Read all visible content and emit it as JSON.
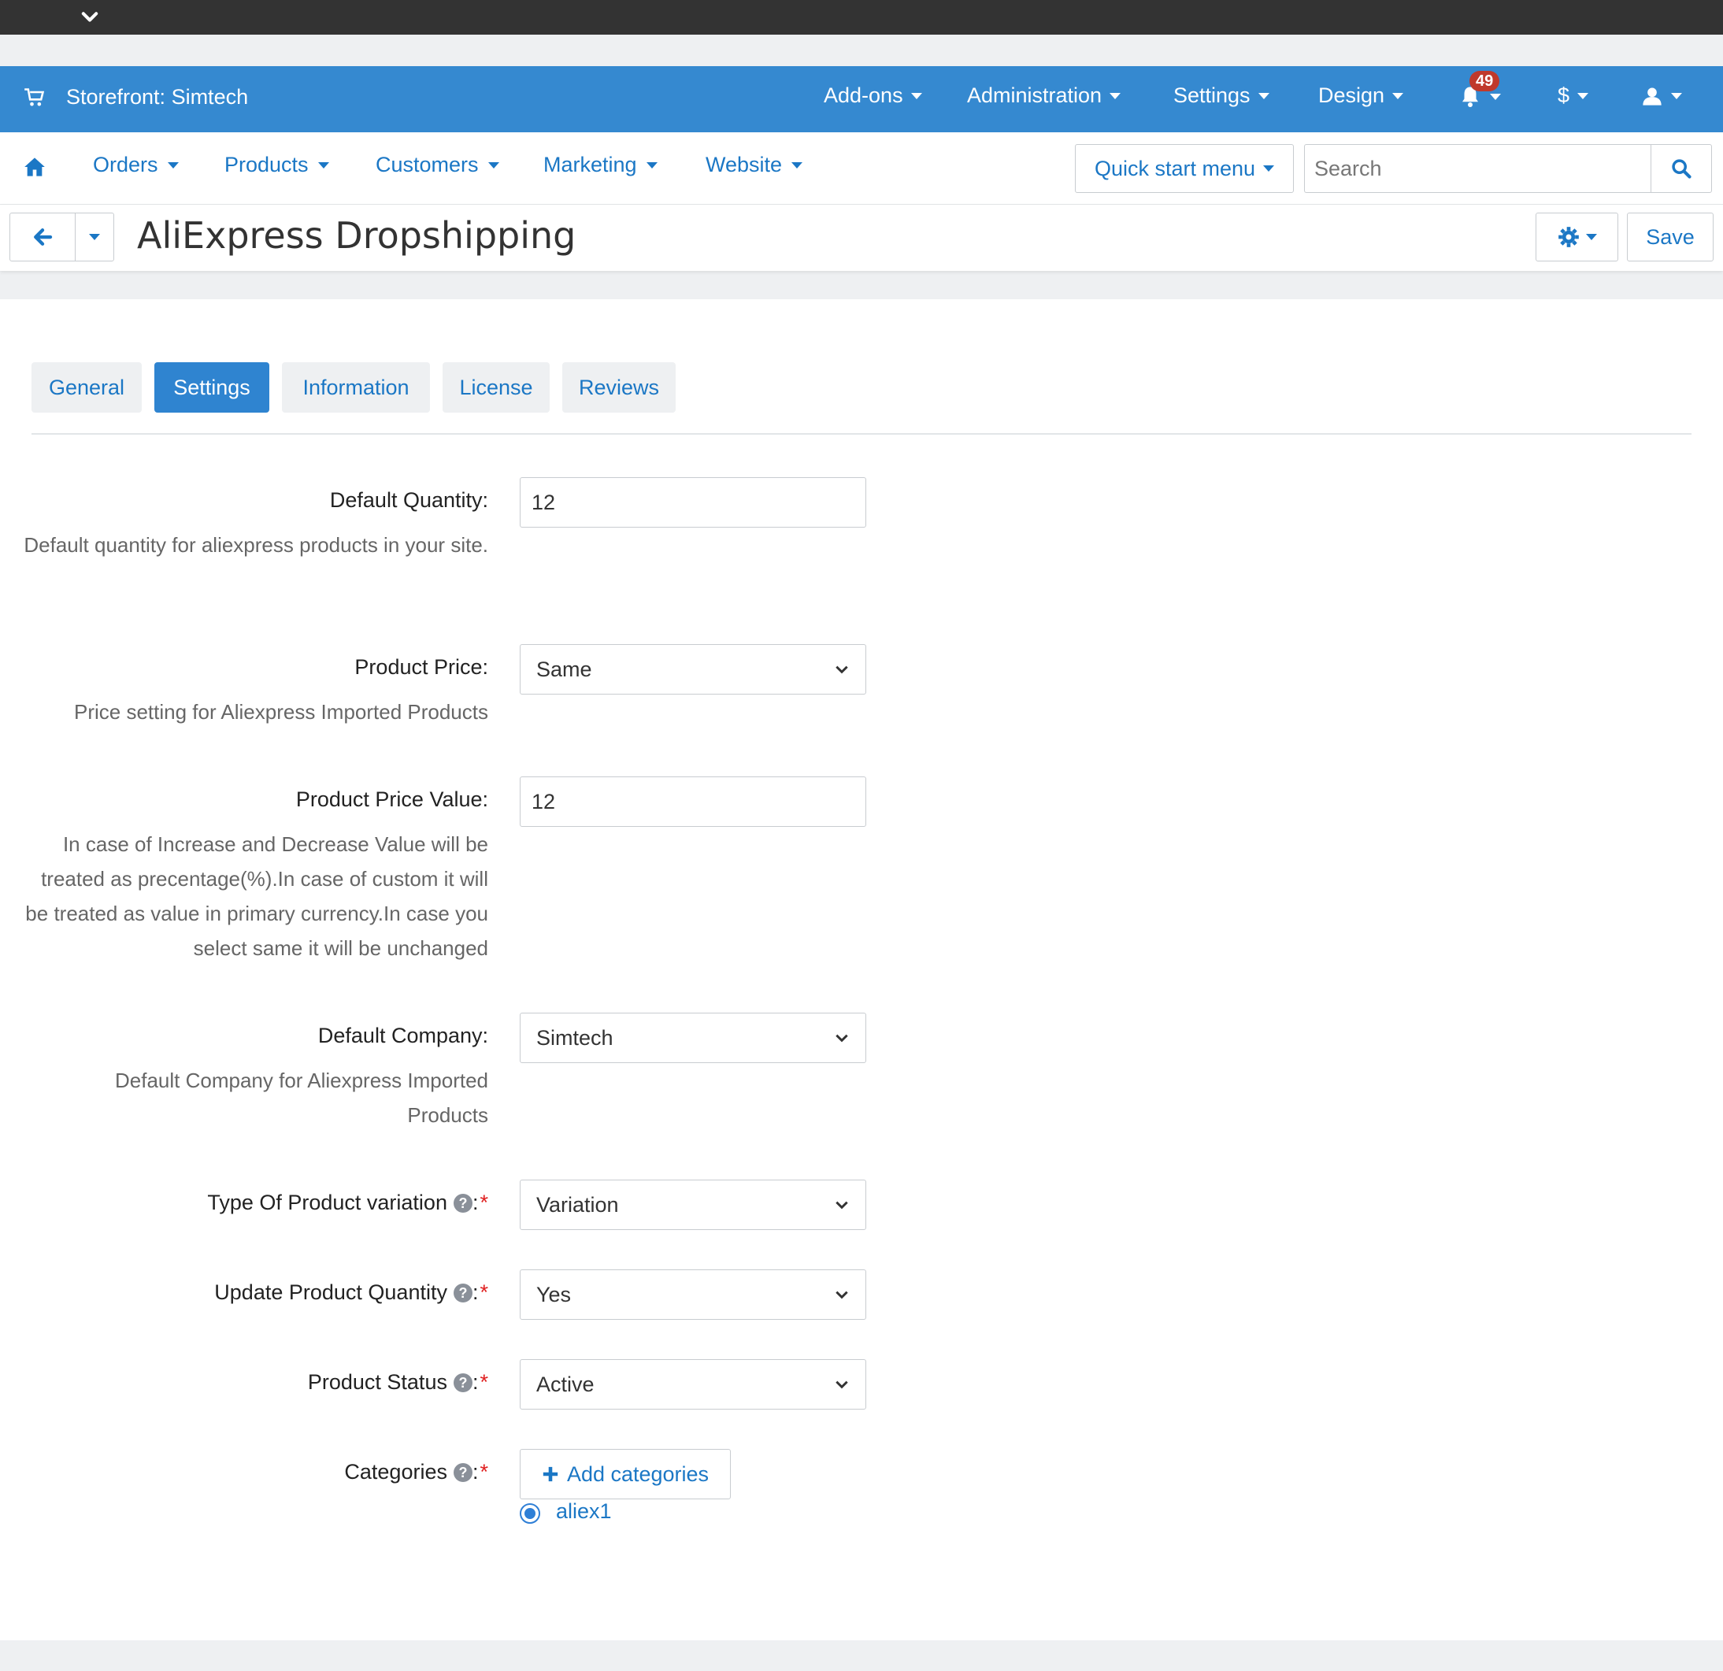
{
  "topbar": {
    "collapse_icon": "chevron-down-icon"
  },
  "header": {
    "storefront": "Storefront: Simtech",
    "menus": [
      "Add-ons",
      "Administration",
      "Settings",
      "Design"
    ],
    "notifications_count": "49",
    "currency": "$"
  },
  "nav": {
    "items": [
      "Orders",
      "Products",
      "Customers",
      "Marketing",
      "Website"
    ],
    "quick_start": "Quick start menu",
    "search_placeholder": "Search"
  },
  "toolbar": {
    "title": "AliExpress Dropshipping",
    "save": "Save"
  },
  "tabs": [
    "General",
    "Settings",
    "Information",
    "License",
    "Reviews"
  ],
  "active_tab": "Settings",
  "fields": {
    "default_quantity": {
      "label": "Default Quantity:",
      "value": "12",
      "desc": "Default quantity for aliexpress products in your site."
    },
    "product_price": {
      "label": "Product Price:",
      "value": "Same",
      "desc": "Price setting for Aliexpress Imported Products"
    },
    "product_price_value": {
      "label": "Product Price Value:",
      "value": "12",
      "desc": "In case of Increase and Decrease Value will be treated as precentage(%).In case of custom it will be treated as value in primary currency.In case you select same it will be unchanged"
    },
    "default_company": {
      "label": "Default Company:",
      "value": "Simtech",
      "desc": "Default Company for Aliexpress Imported Products"
    },
    "variation_type": {
      "label": "Type Of Product variation",
      "value": "Variation"
    },
    "update_quantity": {
      "label": "Update Product Quantity",
      "value": "Yes"
    },
    "product_status": {
      "label": "Product Status",
      "value": "Active"
    },
    "categories": {
      "label": "Categories",
      "add_button": "Add categories",
      "selected": "aliex1"
    }
  },
  "colors": {
    "brand_blue": "#3589d0",
    "link_blue": "#1b77c5",
    "badge_red": "#c0392b"
  }
}
